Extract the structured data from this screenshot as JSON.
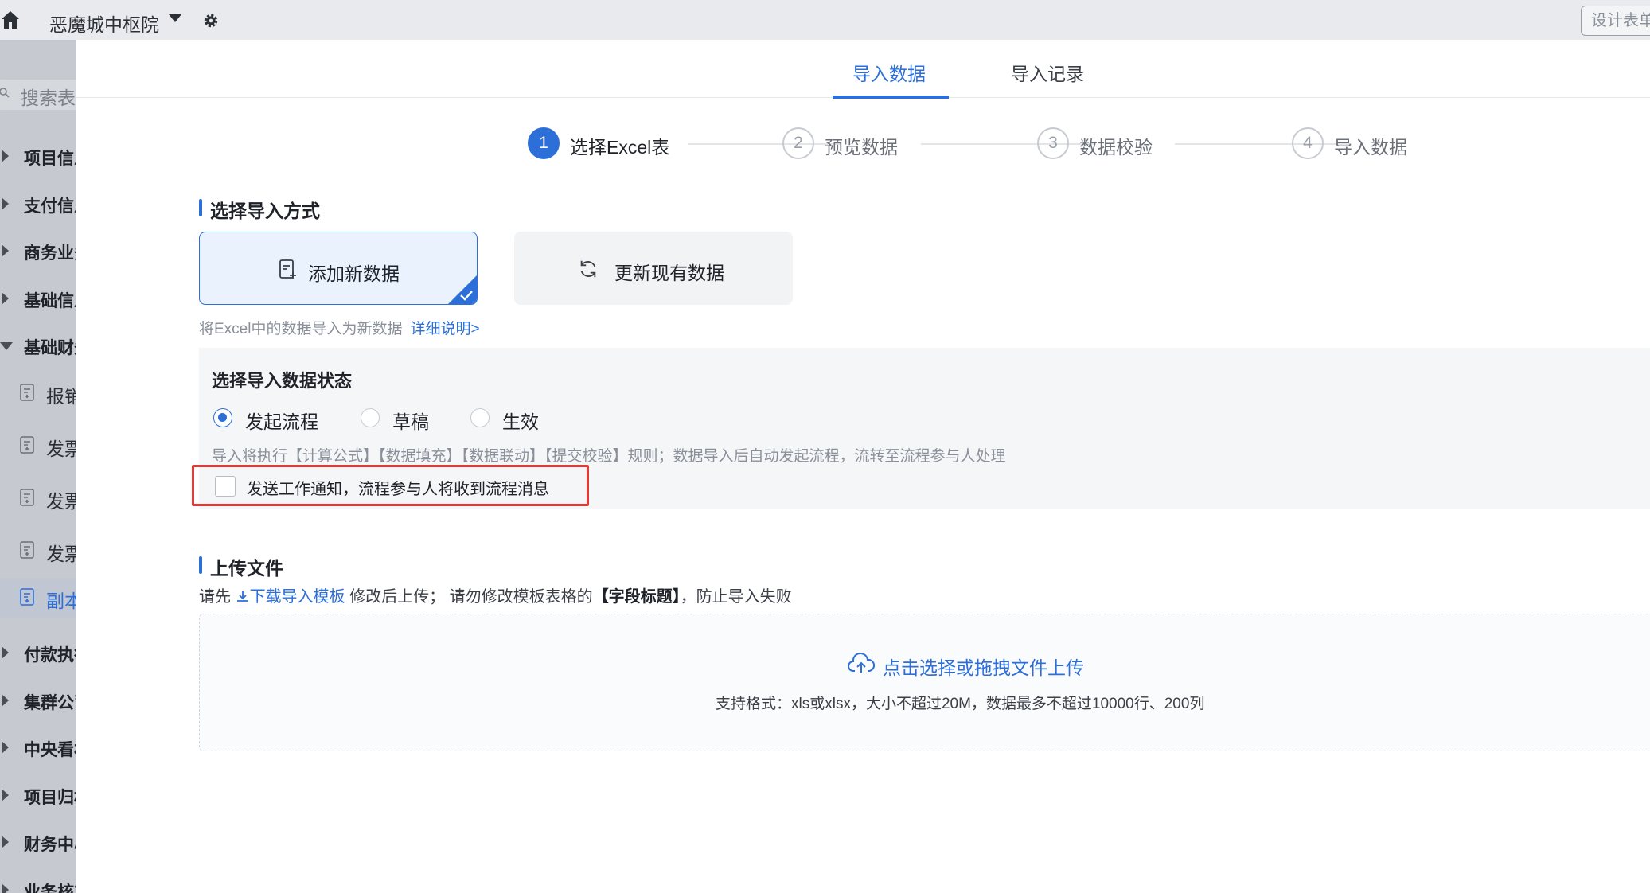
{
  "app": {
    "name": "恶魔城中枢院",
    "design_button": "设计表单"
  },
  "sidebar": {
    "search_placeholder": "搜索表单",
    "items": [
      {
        "type": "group",
        "label": "项目信息",
        "open": false
      },
      {
        "type": "group",
        "label": "支付信息",
        "open": false
      },
      {
        "type": "group",
        "label": "商务业务",
        "open": false
      },
      {
        "type": "group",
        "label": "基础信息",
        "open": false
      },
      {
        "type": "group",
        "label": "基础财务",
        "open": true
      },
      {
        "type": "form",
        "label": "报销"
      },
      {
        "type": "form",
        "label": "发票"
      },
      {
        "type": "form",
        "label": "发票"
      },
      {
        "type": "form",
        "label": "发票"
      },
      {
        "type": "form",
        "label": "副本",
        "active": true
      },
      {
        "type": "group",
        "label": "付款执行",
        "open": false
      },
      {
        "type": "group",
        "label": "集群公司",
        "open": false
      },
      {
        "type": "group",
        "label": "中央看板",
        "open": false
      },
      {
        "type": "group",
        "label": "项目归档",
        "open": false
      },
      {
        "type": "group",
        "label": "财务中心",
        "open": false
      },
      {
        "type": "group",
        "label": "业务核算",
        "open": false
      }
    ]
  },
  "tabs": [
    {
      "label": "导入数据",
      "active": true
    },
    {
      "label": "导入记录",
      "active": false
    }
  ],
  "steps": [
    {
      "num": "1",
      "label": "选择Excel表",
      "active": true
    },
    {
      "num": "2",
      "label": "预览数据",
      "active": false
    },
    {
      "num": "3",
      "label": "数据校验",
      "active": false
    },
    {
      "num": "4",
      "label": "导入数据",
      "active": false
    }
  ],
  "import_mode": {
    "title": "选择导入方式",
    "options": [
      {
        "label": "添加新数据",
        "selected": true
      },
      {
        "label": "更新现有数据",
        "selected": false
      }
    ],
    "hint": "将Excel中的数据导入为新数据",
    "hint_link": "详细说明>"
  },
  "status": {
    "title": "选择导入数据状态",
    "options": [
      {
        "label": "发起流程",
        "checked": true
      },
      {
        "label": "草稿",
        "checked": false
      },
      {
        "label": "生效",
        "checked": false
      }
    ],
    "description": "导入将执行【计算公式】【数据填充】【数据联动】【提交校验】规则；数据导入后自动发起流程，流转至流程参与人处理",
    "notify_label": "发送工作通知，流程参与人将收到流程消息",
    "notify_checked": false
  },
  "upload": {
    "title": "上传文件",
    "hint_prefix": "请先",
    "hint_link": "下载导入模板",
    "hint_middle": "修改后上传；  请勿修改模板表格的",
    "hint_bold": "【字段标题】",
    "hint_suffix": "，防止导入失败",
    "dropzone_title": "点击选择或拖拽文件上传",
    "dropzone_desc": "支持格式：xls或xlsx，大小不超过20M，数据最多不超过10000行、200列"
  },
  "colors": {
    "accent": "#2d6fd8",
    "highlight": "#e53935"
  }
}
